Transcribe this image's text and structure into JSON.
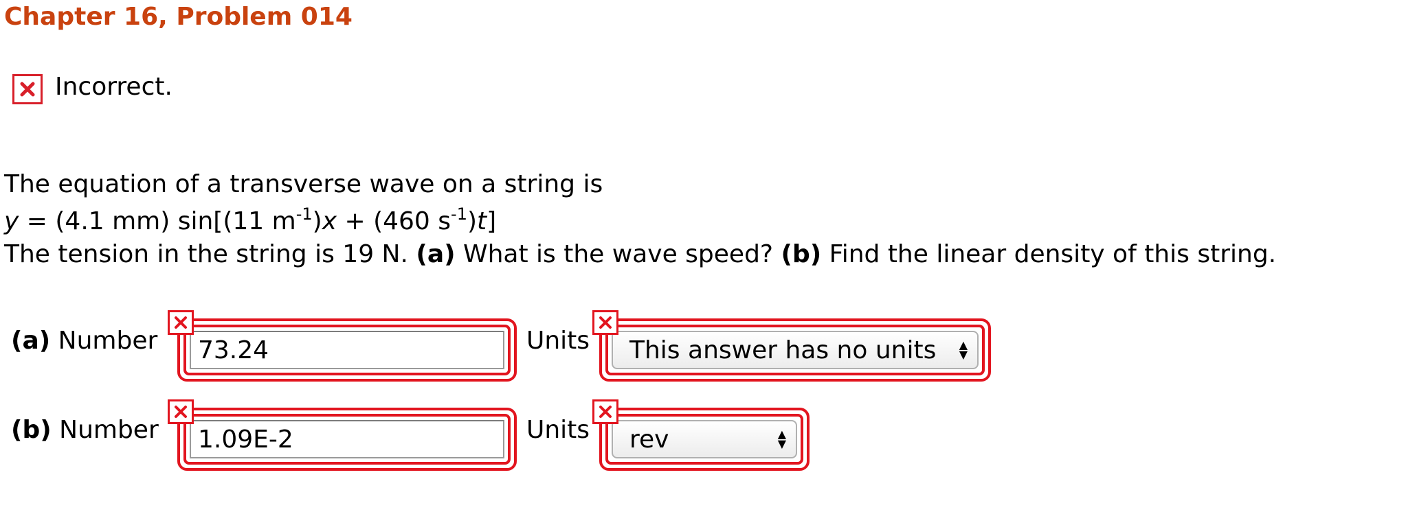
{
  "header": {
    "title": "Chapter 16, Problem 014"
  },
  "status": {
    "icon": "incorrect-x-icon",
    "text": "Incorrect."
  },
  "problem": {
    "line1": "The equation of a transverse wave on a string is",
    "equation": {
      "y": "y",
      "eq1": " = (4.1 mm) sin[(11 m",
      "exp1": "-1",
      "mid": ")",
      "x": "x",
      "eq2": " + (460 s",
      "exp2": "-1",
      "mid2": ")",
      "t": "t",
      "end": "]"
    },
    "line3": {
      "pre": "The tension in the string is 19 N. ",
      "a_label": "(a)",
      "a_text": " What is the wave speed? ",
      "b_label": "(b)",
      "b_text": " Find the linear density of this string."
    }
  },
  "answers": [
    {
      "part": "(a)",
      "number_label": "Number",
      "value": "73.24",
      "units_label": "Units",
      "units_selected": "This answer has no units"
    },
    {
      "part": "(b)",
      "number_label": "Number",
      "value": "1.09E-2",
      "units_label": "Units",
      "units_selected": "rev"
    }
  ],
  "colors": {
    "title": "#c9420f",
    "error": "#e2151f"
  }
}
